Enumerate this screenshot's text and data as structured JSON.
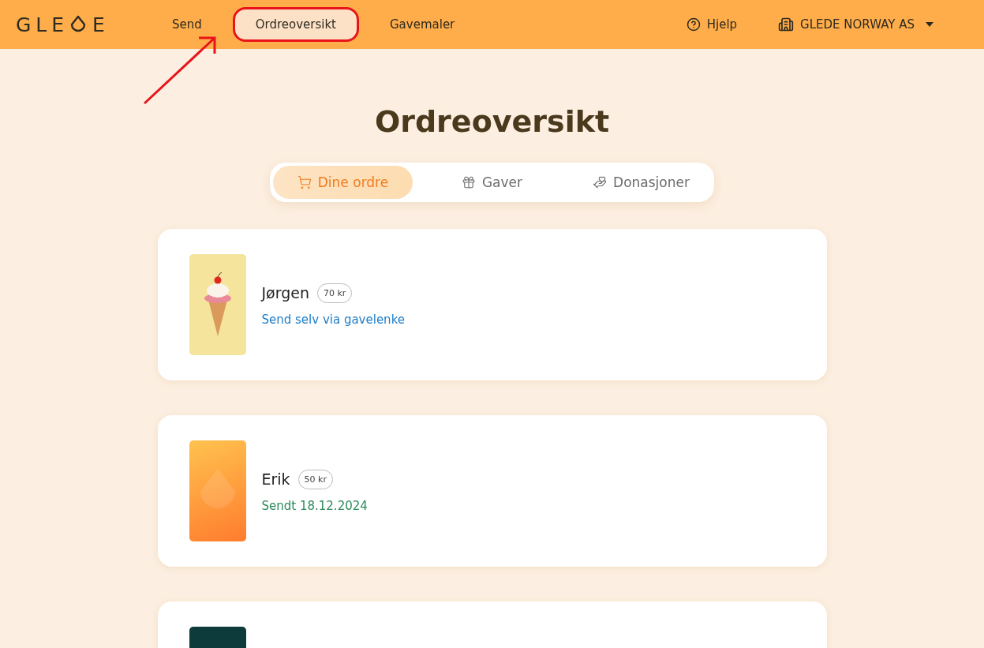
{
  "header": {
    "logo": {
      "before": "GLE",
      "after": "E"
    },
    "nav": [
      {
        "label": "Send",
        "selected": false,
        "circled": false
      },
      {
        "label": "Ordreoversikt",
        "selected": true,
        "circled": true
      },
      {
        "label": "Gavemaler",
        "selected": false,
        "circled": false
      }
    ],
    "help": "Hjelp",
    "company": "GLEDE NORWAY AS"
  },
  "annotation_arrow": true,
  "title": "Ordreoversikt",
  "tabs": [
    {
      "label": "Dine ordre",
      "kind": "cart",
      "selected": true
    },
    {
      "label": "Gaver",
      "kind": "gift",
      "selected": false
    },
    {
      "label": "Donasjoner",
      "kind": "donation",
      "selected": false
    }
  ],
  "orders": [
    {
      "kind": "ice-cream",
      "name": "Jørgen",
      "amount": "70 kr",
      "status": {
        "kind": "link",
        "text": "Send selv via gavelenke"
      }
    },
    {
      "kind": "orange-card",
      "name": "Erik",
      "amount": "50 kr",
      "status": {
        "kind": "sent",
        "text": "Sendt 18.12.2024"
      }
    },
    {
      "kind": "dark-card"
    }
  ]
}
